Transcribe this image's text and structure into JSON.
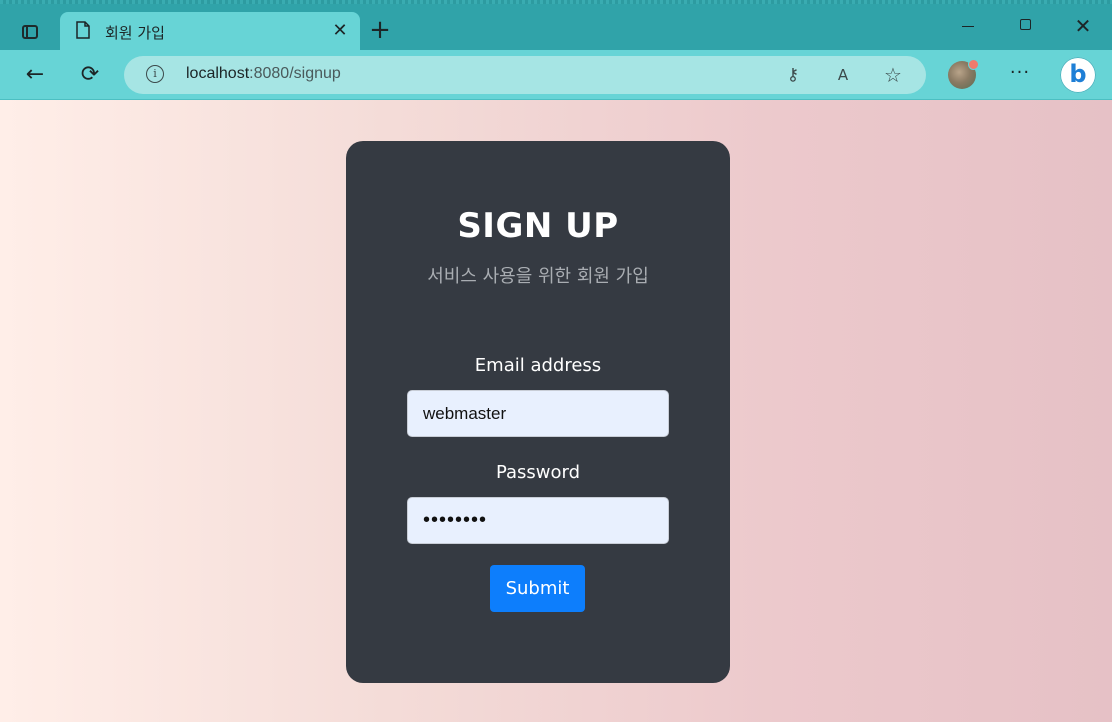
{
  "browser": {
    "tab_title": "회원 가입",
    "tab_close": "✕",
    "new_tab": "+",
    "url_host": "localhost",
    "url_path": ":8080/signup",
    "window_close": "✕",
    "more": "···",
    "back": "←",
    "refresh": "⟳",
    "key": "⚷",
    "read_aloud": "A",
    "favorite": "☆",
    "info": "i",
    "theme_color": "#30a3a9",
    "toolbar_color": "#67d4d6"
  },
  "page": {
    "title": "SIGN UP",
    "subtitle": "서비스 사용을 위한 회원 가입",
    "form": {
      "email_label": "Email address",
      "email_value": "webmaster",
      "password_label": "Password",
      "password_value": "12345678",
      "submit_label": "Submit"
    },
    "colors": {
      "card": "#353a42",
      "submit": "#0d7efc",
      "input_bg": "#e8f0fe"
    }
  }
}
